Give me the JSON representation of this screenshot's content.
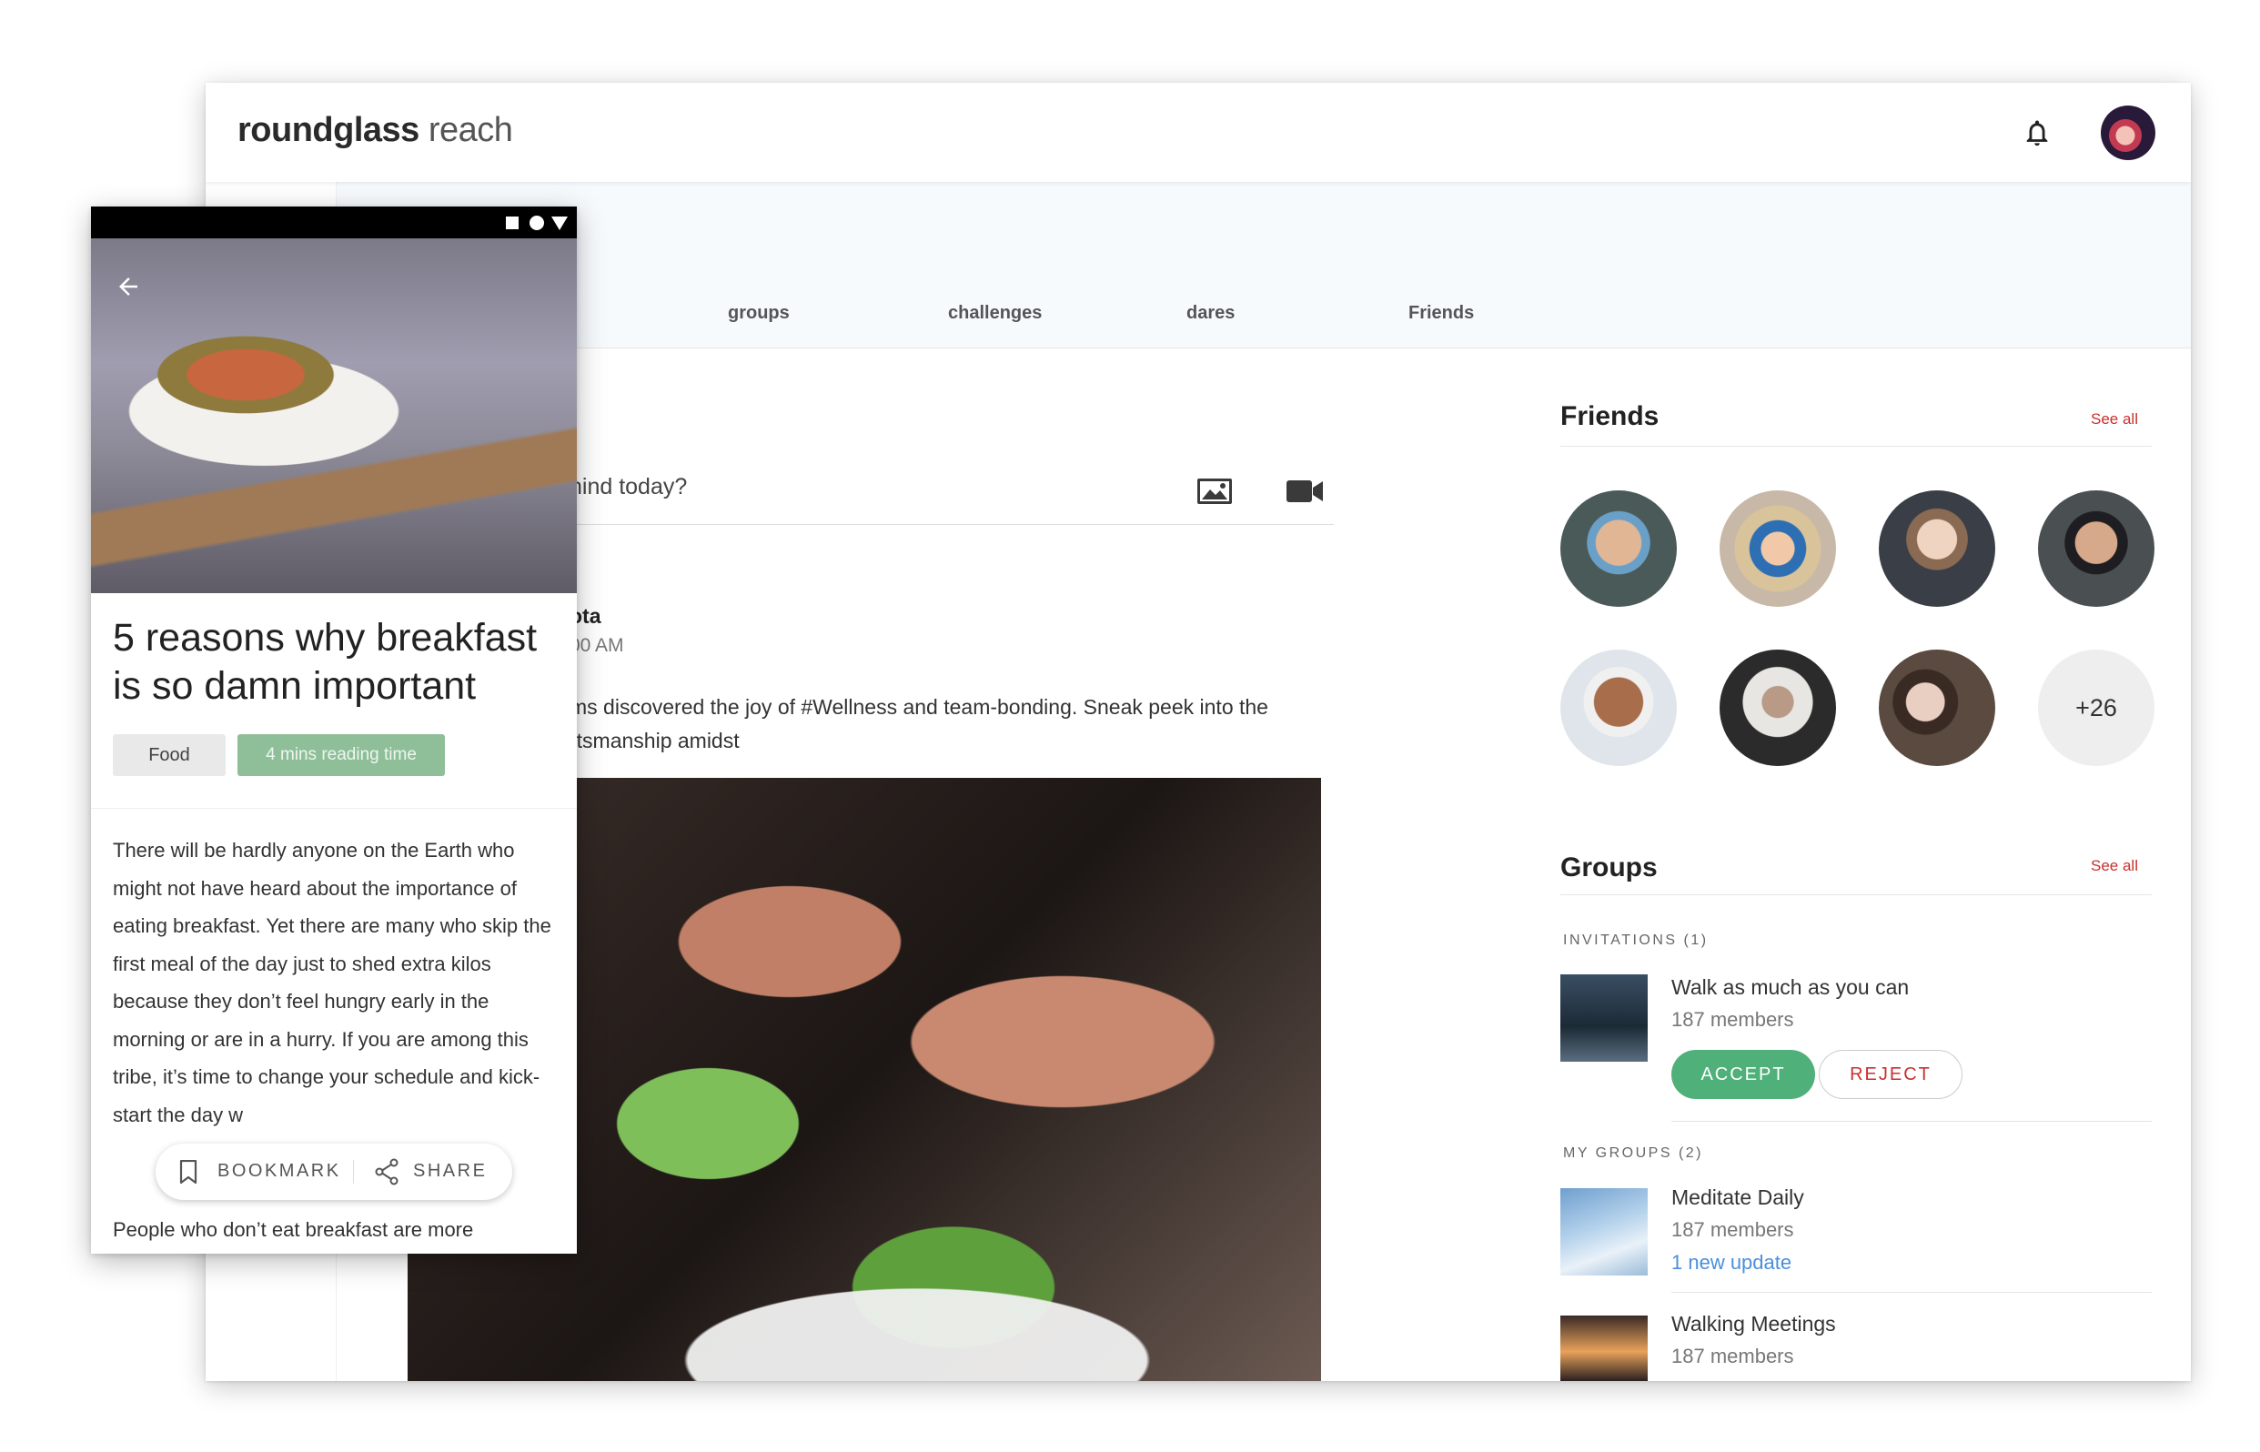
{
  "app": {
    "logo_bold": "roundglass",
    "logo_light": "reach"
  },
  "header": {
    "bell_icon": "bell-icon",
    "avatar_icon": "user-avatar"
  },
  "tabs": [
    {
      "label": "groups"
    },
    {
      "label": "challenges"
    },
    {
      "label": "dares"
    },
    {
      "label": "Friends"
    }
  ],
  "composer": {
    "placeholder_visible": "hind today?",
    "image_icon": "image-icon",
    "video_icon": "video-camera-icon"
  },
  "post": {
    "author_partial": "ota",
    "time_partial": "00 AM",
    "body_line1": "ms discovered the joy of #Wellness and team-bonding. Sneak peek into the",
    "body_line2": "rtsmanship amidst"
  },
  "friends": {
    "title": "Friends",
    "see_all": "See all",
    "more_count": "+26"
  },
  "groups": {
    "title": "Groups",
    "see_all": "See all",
    "invitations_label": "INVITATIONS (1)",
    "invitation": {
      "name": "Walk as much as you can",
      "members": "187 members",
      "accept": "ACCEPT",
      "reject": "REJECT"
    },
    "my_groups_label": "MY GROUPS (2)",
    "my_groups": [
      {
        "name": "Meditate Daily",
        "members": "187 members",
        "update": "1 new update"
      },
      {
        "name": "Walking Meetings",
        "members": "187 members"
      }
    ]
  },
  "phone": {
    "article_title": "5 reasons why breakfast is so damn important",
    "tag_food": "Food",
    "tag_time": "4 mins reading time",
    "body": "There will be hardly anyone on the Earth who might not have heard about the importance of eating breakfast. Yet there are many who skip the first meal of the day just to shed extra kilos because they don’t feel hungry early in the morning or are in a hurry. If you are among this tribe, it’s time to change your schedule and kick-start the day w",
    "body2": "People who don’t eat breakfast are more",
    "bookmark": "BOOKMARK",
    "share": "SHARE"
  },
  "colors": {
    "accent_red": "#c8302f",
    "accept_green": "#4fb07a",
    "update_blue": "#4a8fdc",
    "tag_green": "#8fbf99"
  }
}
